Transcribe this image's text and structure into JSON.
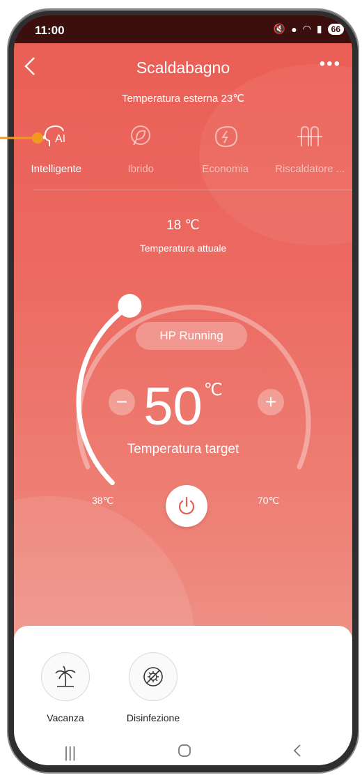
{
  "status_bar": {
    "time": "11:00",
    "battery": "66"
  },
  "header": {
    "title": "Scaldabagno",
    "subtitle": "Temperatura esterna 23℃"
  },
  "modes": [
    {
      "label": "Intelligente",
      "icon": "ai-head-icon",
      "active": true
    },
    {
      "label": "Ibrido",
      "icon": "hybrid-icon",
      "active": false
    },
    {
      "label": "Economia",
      "icon": "eco-leaf-icon",
      "active": false
    },
    {
      "label": "Riscaldatore ...",
      "icon": "heater-icon",
      "active": false
    }
  ],
  "current": {
    "value": "18 ℃",
    "label": "Temperatura attuale"
  },
  "control": {
    "status": "HP Running",
    "target_value": "50",
    "target_unit": "℃",
    "target_label": "Temperatura target",
    "min_label": "38℃",
    "max_label": "70℃",
    "min": 38,
    "max": 70,
    "target": 50
  },
  "features": [
    {
      "label": "Vacanza",
      "icon": "palm-tree-icon"
    },
    {
      "label": "Disinfezione",
      "icon": "disinfection-icon"
    }
  ],
  "colors": {
    "accent": "#ea5d54",
    "annotation": "#f29a1d"
  }
}
